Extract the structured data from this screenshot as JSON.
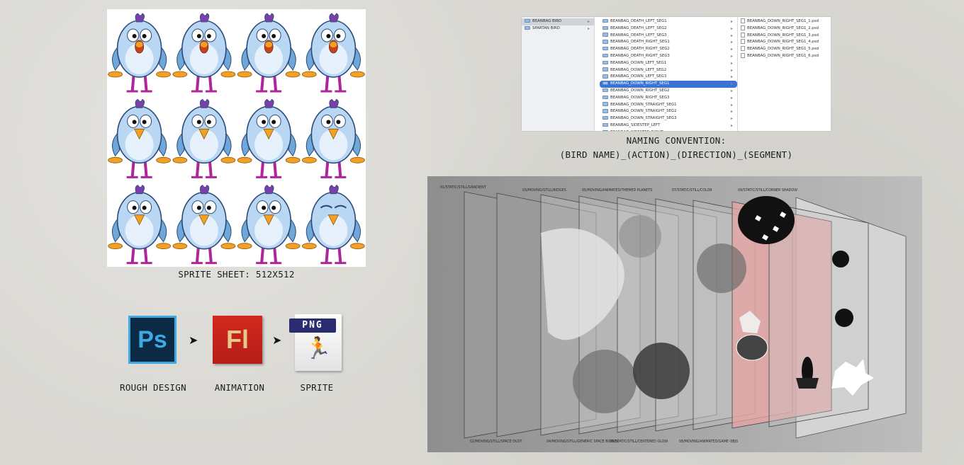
{
  "sprite_sheet": {
    "caption": "SPRITE SHEET: 512X512",
    "rows": 3,
    "cols": 4
  },
  "finder": {
    "col1": [
      "BEANBAG BIRD",
      "SPARTAN BIRD"
    ],
    "col2": [
      "BEANBAG_DEATH_LEFT_SEG1",
      "BEANBAG_DEATH_LEFT_SEG2",
      "BEANBAG_DEATH_LEFT_SEG3",
      "BEANBAG_DEATH_RIGHT_SEG1",
      "BEANBAG_DEATH_RIGHT_SEG2",
      "BEANBAG_DEATH_RIGHT_SEG3",
      "BEANBAG_DOWN_LEFT_SEG1",
      "BEANBAG_DOWN_LEFT_SEG2",
      "BEANBAG_DOWN_LEFT_SEG3",
      "BEANBAG_DOWN_RIGHT_SEG1",
      "BEANBAG_DOWN_RIGHT_SEG2",
      "BEANBAG_DOWN_RIGHT_SEG3",
      "BEANBAG_DOWN_STRAIGHT_SEG1",
      "BEANBAG_DOWN_STRAIGHT_SEG2",
      "BEANBAG_DOWN_STRAIGHT_SEG3",
      "BEANBAG_SIDESTEP_LEFT",
      "BEANBAG_SIDESTEP_RIGHT"
    ],
    "col2_selected": 9,
    "col3": [
      "BEANBAG_DOWN_RIGHT_SEG1_1.psd",
      "BEANBAG_DOWN_RIGHT_SEG1_2.psd",
      "BEANBAG_DOWN_RIGHT_SEG1_3.psd",
      "BEANBAG_DOWN_RIGHT_SEG1_4.psd",
      "BEANBAG_DOWN_RIGHT_SEG1_5.psd",
      "BEANBAG_DOWN_RIGHT_SEG1_6.psd"
    ]
  },
  "naming": {
    "line1": "NAMING CONVENTION:",
    "line2": "(BIRD NAME)_(ACTION)_(DIRECTION)_(SEGMENT)"
  },
  "workflow": {
    "steps": [
      {
        "icon": "photoshop-icon",
        "icon_text": "Ps",
        "label": "ROUGH DESIGN",
        "color": "#0b2a43",
        "accent": "#3ea8e5"
      },
      {
        "icon": "flash-icon",
        "icon_text": "Fl",
        "label": "ANIMATION",
        "color": "#b51e17",
        "accent": "#e4c98a"
      },
      {
        "icon": "png-file-icon",
        "icon_text": "PNG",
        "label": "SPRITE",
        "color": "#2a2c70",
        "accent": "#ffffff"
      }
    ],
    "arrow": "➤"
  },
  "layers": {
    "top_labels": [
      "01/STATIC/STILL/GRADIENT",
      "03/MOVING/STILL/RIDGES",
      "05/MOVING/ANIMATED/THEMED PLANETS",
      "07/STATIC/STILL/COLOR",
      "09/STATIC/STILL/CORNER SHADOW"
    ],
    "bottom_labels": [
      "02/MOVING/STILL/SPACE DUST",
      "04/MOVING/STILL/GENERIC SPACE BODIES",
      "06/STATIC/STILL/CENTERED GLOW",
      "08/MOVING/ANIMATED/GAME OBJS"
    ]
  },
  "colors": {
    "bird_body": "#b9d6f2",
    "bird_outline": "#2a4c7a",
    "beak": "#f4a024",
    "legs": "#b0259a",
    "selection": "#3a73d3",
    "layer_pink": "#e8a3a3"
  }
}
